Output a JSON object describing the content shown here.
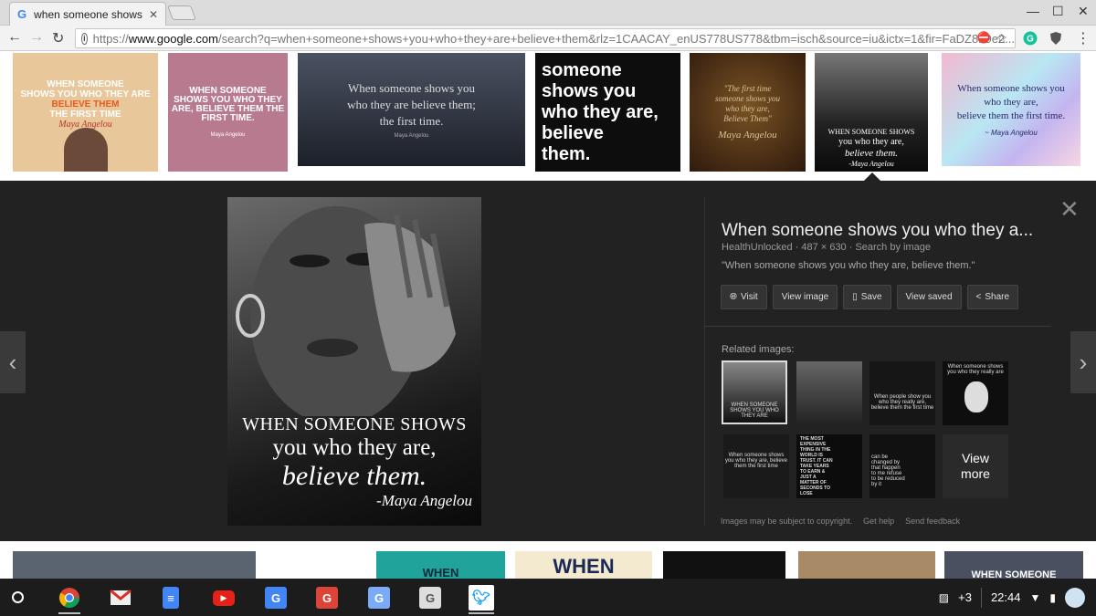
{
  "browser": {
    "tab_title": "when someone shows yo",
    "tab_favicon": "G",
    "url_prefix": "https://",
    "url_domain": "www.google.com",
    "url_rest": "/search?q=when+someone+shows+you+who+they+are+believe+them&rlz=1CAACAY_enUS778US778&tbm=isch&source=iu&ictx=1&fir=FaDZ8h9e2..."
  },
  "results_row": [
    {
      "lines": [
        "WHEN SOMEONE",
        "SHOWS YOU WHO THEY ARE",
        "BELIEVE THEM",
        "THE FIRST TIME"
      ],
      "author": "Maya Angelou",
      "bg": "#e8c79a"
    },
    {
      "lines": [
        "WHEN SOMEONE",
        "SHOWS YOU WHO THEY",
        "ARE, BELIEVE THEM THE",
        "FIRST TIME."
      ],
      "author": "Maya Angelou",
      "bg": "#b87a8e"
    },
    {
      "lines": [
        "When someone shows you",
        "who they are believe them;",
        "the first time."
      ],
      "author": "Maya Angelou",
      "bg": "#2e3440"
    },
    {
      "lines": [
        "someone",
        "shows you",
        "who they are,",
        "believe",
        "them."
      ],
      "author": "",
      "bg": "#0d0d0d"
    },
    {
      "lines": [
        "\"The first time",
        "someone shows you",
        "who they are,",
        "Believe Them\""
      ],
      "author": "Maya Angelou",
      "bg": "#4a2c14"
    },
    {
      "lines": [
        "WHEN SOMEONE SHOWS",
        "you who they are,",
        "believe them.",
        "-Maya Angelou"
      ],
      "author": "",
      "bg": "#1e1e1e"
    },
    {
      "lines": [
        "When someone shows you",
        "who they are,",
        "believe them the first time."
      ],
      "author": "~ Maya Angelou",
      "bg": "#c9e4ef"
    }
  ],
  "preview": {
    "caption_line1": "WHEN SOMEONE SHOWS",
    "caption_line2": "you who they are,",
    "caption_line3": "believe them.",
    "caption_author": "-Maya Angelou",
    "title": "When someone shows you who they a...",
    "meta": "HealthUnlocked · 487 × 630 · Search by image",
    "description": "\"When someone shows you who they are, believe them.\"",
    "buttons": {
      "visit": "Visit",
      "view_image": "View image",
      "save": "Save",
      "view_saved": "View saved",
      "share": "Share"
    },
    "related_label": "Related images:",
    "related": [
      {
        "text": "WHEN SOMEONE SHOWS YOU WHO THEY ARE"
      },
      {
        "text": ""
      },
      {
        "text": "When people show you who they really are, believe them the first time"
      },
      {
        "text": "When someone shows you who they really are"
      },
      {
        "text": "When someone shows you who they are, believe them the first time"
      },
      {
        "text": "THE MOST EXPENSIVE THING IN THE WORLD IS TRUST. IT CAN TAKE YEARS TO EARN & JUST A MATTER OF SECONDS TO LOSE"
      },
      {
        "text": "can be changed by that happen to me refuse to be reduced by it"
      },
      {
        "text": "View more"
      }
    ],
    "footer": {
      "notice": "Images may be subject to copyright.",
      "help": "Get help",
      "feedback": "Send feedback"
    }
  },
  "bottom_peek": [
    {
      "text": "",
      "bg": "#5a6470"
    },
    {
      "text": "WHEN",
      "bg": "#1fa39a",
      "color": "#0a2a3a"
    },
    {
      "text": "WHEN",
      "bg": "#f4ead0",
      "color": "#1b2a55"
    },
    {
      "text": "",
      "bg": "#111"
    },
    {
      "text": "",
      "bg": "#a88a66"
    },
    {
      "text": "WHEN SOMEONE",
      "bg": "#4a5060",
      "color": "#fff"
    }
  ],
  "shelf": {
    "apps": [
      "chrome-icon",
      "gmail-icon",
      "docs-icon",
      "youtube-icon",
      "G",
      "G",
      "G",
      "G",
      "twitter-icon"
    ],
    "notif_count": "+3",
    "clock": "22:44"
  }
}
